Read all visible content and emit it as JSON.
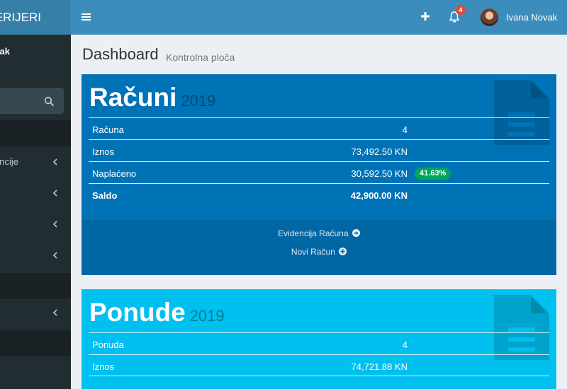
{
  "app": {
    "logo_text": "ERIJERI"
  },
  "sidebar": {
    "user_name": "ak",
    "items": [
      {
        "label": "encije"
      },
      {
        "label": ""
      },
      {
        "label": ""
      },
      {
        "label": ""
      },
      {
        "label": ""
      }
    ]
  },
  "topbar": {
    "notifications_count": "4",
    "user_name": "Ivana Novak"
  },
  "page": {
    "title": "Dashboard",
    "subtitle": "Kontrolna ploča"
  },
  "racuni": {
    "title": "Računi",
    "year": "2019",
    "rows": [
      {
        "label": "Računa",
        "value": "4"
      },
      {
        "label": "Iznos",
        "value": "73,492.50 KN"
      },
      {
        "label": "Naplaćeno",
        "value": "30,592.50 KN",
        "badge": "41.63%"
      },
      {
        "label": "Saldo",
        "value": "42,900.00 KN"
      }
    ],
    "links": {
      "evidencija": "Evidencija Računa",
      "novi": "Novi Račun"
    }
  },
  "ponude": {
    "title": "Ponude",
    "year": "2019",
    "rows": [
      {
        "label": "Ponuda",
        "value": "4"
      },
      {
        "label": "Iznos",
        "value": "74,721.88 KN"
      }
    ]
  },
  "colors": {
    "sidebar": "#222d32",
    "topbar": "#3c8dbc",
    "racuni_box": "#0073b7",
    "ponude_box": "#00c0ef",
    "badge_green": "#00a65a",
    "badge_red": "#dd4b39"
  }
}
